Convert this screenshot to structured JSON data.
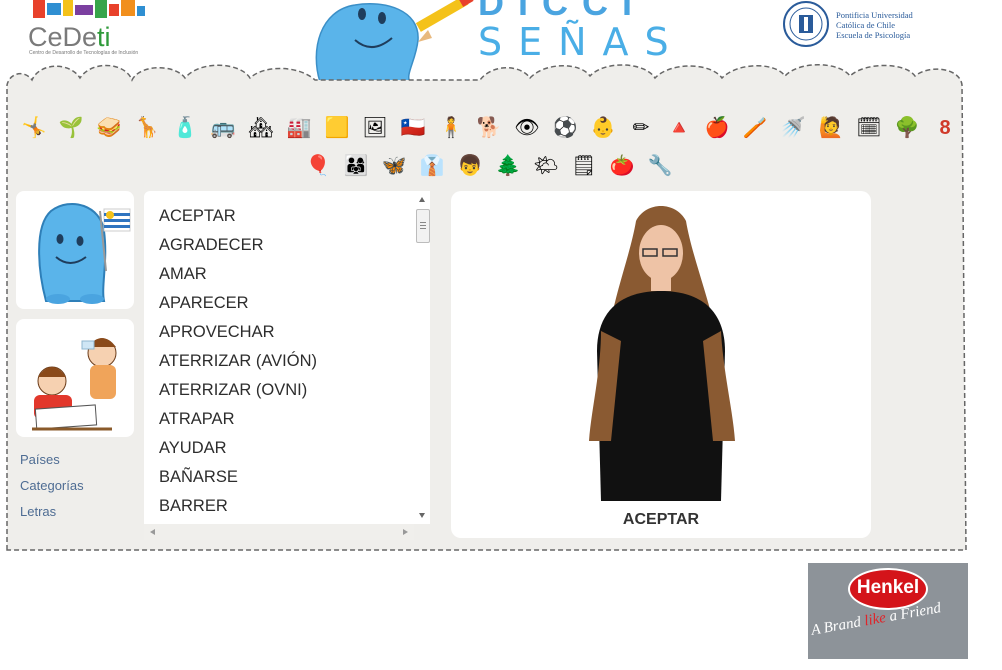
{
  "header": {
    "cedeti_name_a": "CeDe",
    "cedeti_name_b": "ti",
    "cedeti_subtitle": "Centro de Desarrollo de Tecnologías de Inclusión",
    "title_top": "DICCI",
    "title_bottom": "SEÑAS",
    "university_lines": [
      "Pontificia Universidad",
      "Católica de Chile",
      "Escuela de Psicología"
    ]
  },
  "categories": {
    "row1": [
      "🤸",
      "🌱",
      "🥪",
      "🦒",
      "🧴",
      "🚌",
      "🏘",
      "🏭",
      "🟨",
      "🖼",
      "🇨🇱",
      "🧍",
      "🐕",
      "👁",
      "⚽",
      "👶",
      "✏",
      "🔺",
      "🍎",
      "🪥",
      "🚿",
      "🙋",
      "🗓",
      "🌳",
      "8"
    ],
    "row2": [
      "🎈",
      "👨‍👩‍👧",
      "🦋",
      "👔",
      "👦",
      "🌲",
      "🌤",
      "🗒",
      "🍅",
      "🔧"
    ]
  },
  "sidebar": {
    "links": [
      "Países",
      "Categorías",
      "Letras"
    ]
  },
  "word_list": [
    "ACEPTAR",
    "AGRADECER",
    "AMAR",
    "APARECER",
    "APROVECHAR",
    "ATERRIZAR (AVIÓN)",
    "ATERRIZAR (OVNI)",
    "ATRAPAR",
    "AYUDAR",
    "BAÑARSE",
    "BARRER"
  ],
  "video": {
    "caption": "ACEPTAR"
  },
  "sponsor": {
    "name": "Henkel",
    "tagline_a": "A Brand ",
    "tagline_b": "like",
    "tagline_c": " a Friend"
  },
  "colors": {
    "panel_bg": "#efeeeb",
    "link": "#4e6c93",
    "henkel_red": "#d4141a"
  }
}
